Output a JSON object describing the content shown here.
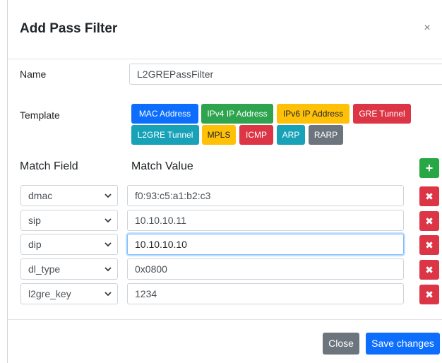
{
  "dialog": {
    "title": "Add Pass Filter",
    "close_glyph": "×"
  },
  "form": {
    "name_label": "Name",
    "name_value": "L2GREPassFilter",
    "template_label": "Template",
    "templates": [
      {
        "label": "MAC Address",
        "color": "#0d6efd"
      },
      {
        "label": "IPv4 IP Address",
        "color": "#2ea44f"
      },
      {
        "label": "IPv6 IP Address",
        "color": "#ffc107"
      },
      {
        "label": "GRE Tunnel",
        "color": "#dc3545"
      },
      {
        "label": "L2GRE Tunnel",
        "color": "#17a2b8"
      },
      {
        "label": "MPLS",
        "color": "#ffc107"
      },
      {
        "label": "ICMP",
        "color": "#dc3545"
      },
      {
        "label": "ARP",
        "color": "#17a2b8"
      },
      {
        "label": "RARP",
        "color": "#6c757d"
      }
    ],
    "match_field_header": "Match Field",
    "match_value_header": "Match Value",
    "add_glyph": "+",
    "delete_glyph": "✖",
    "rows": [
      {
        "field": "dmac",
        "value": "f0:93:c5:a1:b2:c3"
      },
      {
        "field": "sip",
        "value": "10.10.10.11"
      },
      {
        "field": "dip",
        "value": "10.10.10.10"
      },
      {
        "field": "dl_type",
        "value": "0x0800"
      },
      {
        "field": "l2gre_key",
        "value": "1234"
      }
    ]
  },
  "footer": {
    "close_label": "Close",
    "save_label": "Save changes"
  }
}
